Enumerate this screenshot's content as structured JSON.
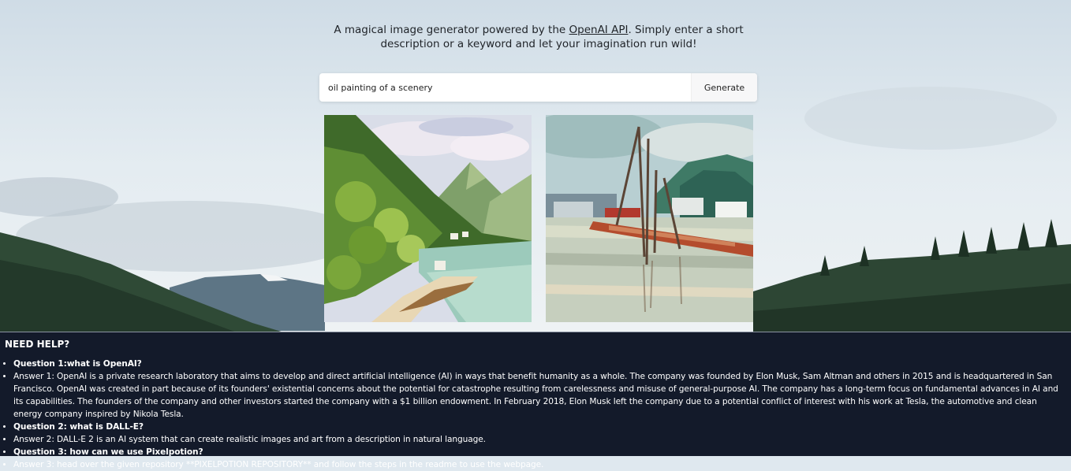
{
  "header": {
    "tagline_before": "A magical image generator powered by the ",
    "tagline_link": "OpenAI API",
    "tagline_after": ". Simply enter a short description or a keyword and let your imagination run wild!"
  },
  "search": {
    "value": "oil painting of a scenery",
    "button_label": "Generate"
  },
  "results": [
    {
      "name": "generated-image-1",
      "subject": "oil painting of green hills, a lake and a path"
    },
    {
      "name": "generated-image-2",
      "subject": "oil painting of boats at a dock on the water"
    }
  ],
  "help": {
    "title": "NEED HELP?",
    "items": [
      {
        "type": "question",
        "text": "Question 1:what is OpenAI?"
      },
      {
        "type": "answer",
        "text": "Answer 1: OpenAI is a private research laboratory that aims to develop and direct artificial intelligence (AI) in ways that benefit humanity as a whole. The company was founded by Elon Musk, Sam Altman and others in 2015 and is headquartered in San Francisco. OpenAI was created in part because of its founders' existential concerns about the potential for catastrophe resulting from carelessness and misuse of general-purpose AI. The company has a long-term focus on fundamental advances in AI and its capabilities. The founders of the company and other investors started the company with a $1 billion endowment. In February 2018, Elon Musk left the company due to a potential conflict of interest with his work at Tesla, the automotive and clean energy company inspired by Nikola Tesla."
      },
      {
        "type": "question",
        "text": "Question 2: what is DALL-E?"
      },
      {
        "type": "answer",
        "text": "Answer 2: DALL-E 2 is an AI system that can create realistic images and art from a description in natural language."
      },
      {
        "type": "question",
        "text": "Question 3: how can we use Pixelpotion?"
      },
      {
        "type": "answer",
        "text": "Answer 3: head over the given repository **PIXELPOTION REPOSITORY** and follow the steps in the readme to use the webpage."
      }
    ]
  },
  "colors": {
    "help_background": "#131a2a",
    "help_text": "#ffffff"
  }
}
